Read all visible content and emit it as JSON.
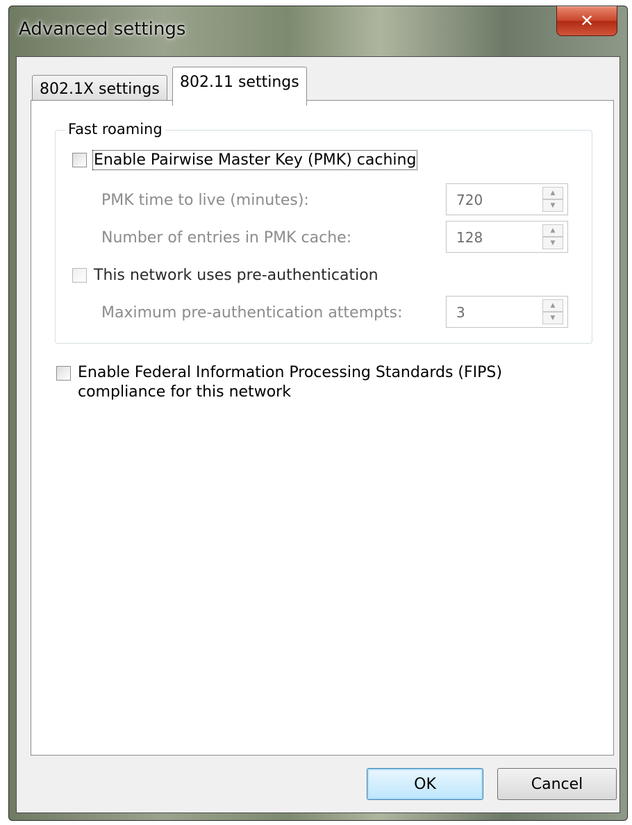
{
  "window": {
    "title": "Advanced settings",
    "close_label": "✕"
  },
  "tabs": [
    {
      "label": "802.1X settings",
      "active": false
    },
    {
      "label": "802.11 settings",
      "active": true
    }
  ],
  "fast_roaming": {
    "legend": "Fast roaming",
    "pmk_caching": {
      "label": "Enable Pairwise Master Key (PMK) caching",
      "checked": false
    },
    "pmk_ttl": {
      "label": "PMK time to live (minutes):",
      "value": "720"
    },
    "pmk_entries": {
      "label": "Number of entries in PMK cache:",
      "value": "128"
    },
    "pre_auth": {
      "label": "This network uses pre-authentication",
      "checked": false
    },
    "pre_auth_attempts": {
      "label": "Maximum pre-authentication attempts:",
      "value": "3"
    }
  },
  "fips": {
    "label_line1": "Enable Federal Information Processing Standards (FIPS)",
    "label_line2": "compliance for this network",
    "checked": false
  },
  "buttons": {
    "ok": "OK",
    "cancel": "Cancel"
  },
  "icons": {
    "spin_up": "▲",
    "spin_down": "▼"
  }
}
